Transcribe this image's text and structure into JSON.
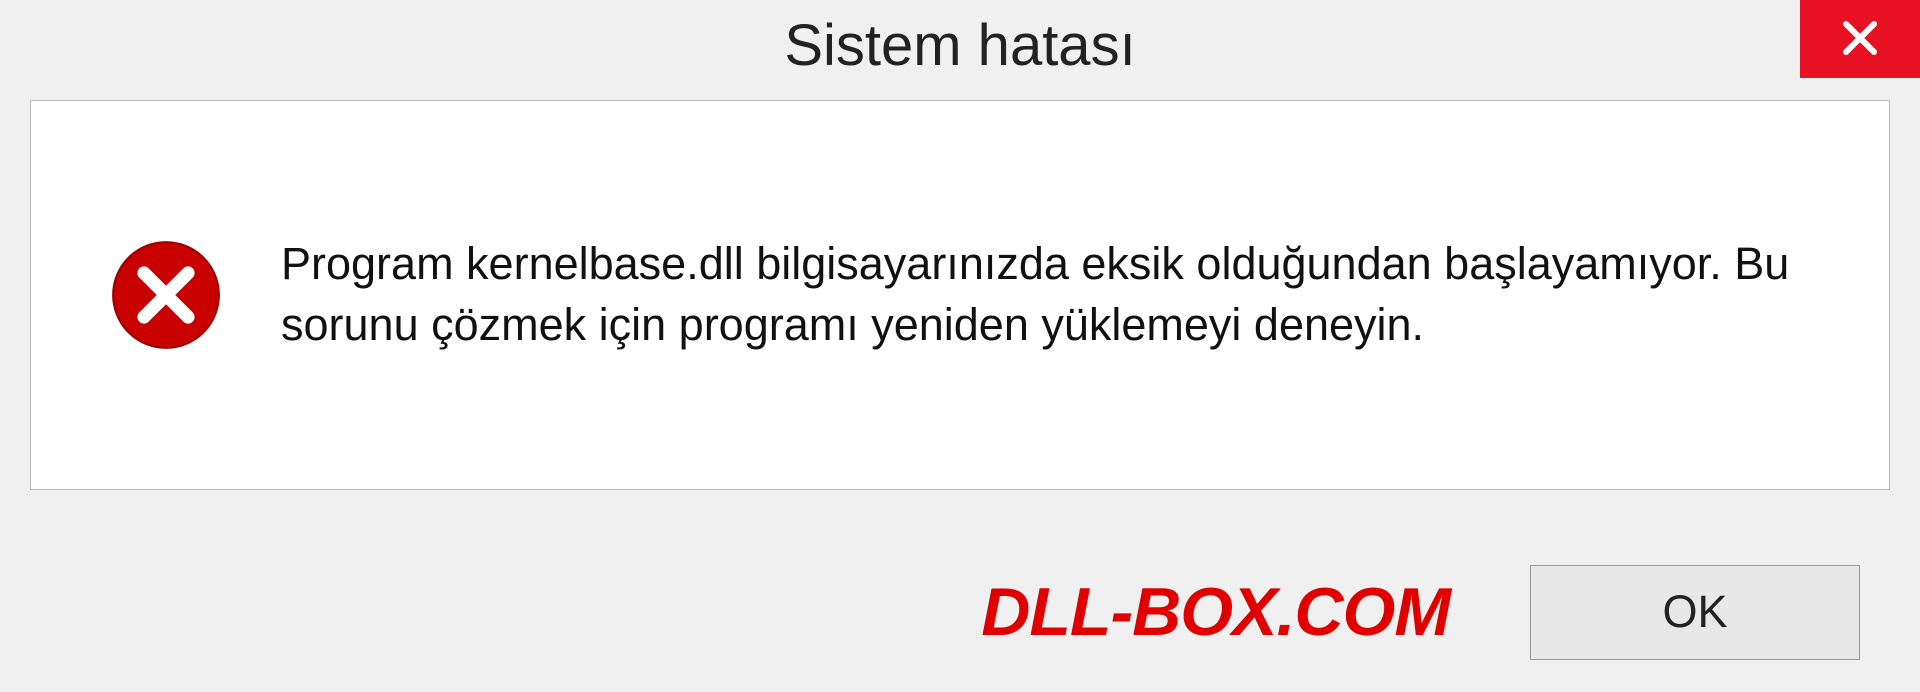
{
  "dialog": {
    "title": "Sistem hatası",
    "message": "Program kernelbase.dll bilgisayarınızda eksik olduğundan başlayamıyor. Bu sorunu çözmek için programı yeniden yüklemeyi deneyin.",
    "ok_label": "OK"
  },
  "watermark": "DLL-BOX.COM",
  "colors": {
    "close_bg": "#e81123",
    "error_icon": "#c80000",
    "watermark": "#e00000"
  }
}
